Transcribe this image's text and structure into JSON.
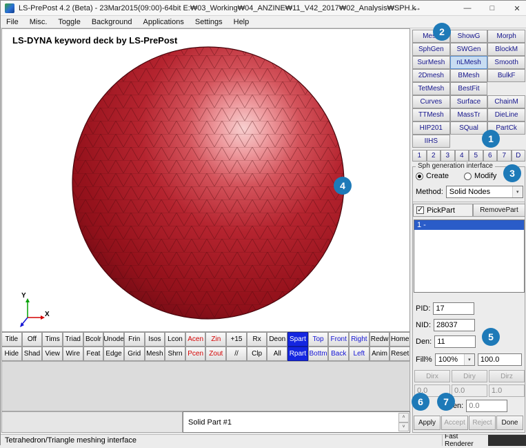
{
  "colors": {
    "annotation_blue": "#1e7ab8",
    "sphere_red": "#a01522",
    "toolbar_red_text": "#d40000",
    "toolbar_blue_text": "#1414d4",
    "toolbar_active_bg": "#1426e0",
    "panel_button_text": "#14148c",
    "selection_blue": "#2a5cc8"
  },
  "titlebar": {
    "app_title": "LS-PrePost 4.2 (Beta) - 23Mar2015(09:00)-64bit E:₩03_Working₩04_ANZINE₩11_V42_2017₩02_Analysis₩SPH.k",
    "resize_glyph": "↔",
    "minimize_glyph": "—",
    "maximize_glyph": "□",
    "close_glyph": "✕"
  },
  "menubar": {
    "items": [
      "File",
      "Misc.",
      "Toggle",
      "Background",
      "Applications",
      "Settings",
      "Help"
    ]
  },
  "viewport": {
    "caption": "LS-DYNA keyword deck by LS-PrePost",
    "axis_y_label": "Y",
    "axis_x_label": "X"
  },
  "mesh_tools": {
    "labels": [
      "Mesh",
      "ShowG",
      "Morph",
      "SphGen",
      "SWGen",
      "BlockM",
      "SurMesh",
      "nLMesh",
      "Smooth",
      "2Dmesh",
      "BMesh",
      "BulkF",
      "TetMesh",
      "BestFit",
      "",
      "Curves",
      "Surface",
      "ChainM",
      "TTMesh",
      "MassTr",
      "DieLine",
      "HIP201",
      "SQual",
      "PartCk",
      "IIHS",
      "",
      ""
    ]
  },
  "page_tabs": [
    "1",
    "2",
    "3",
    "4",
    "5",
    "6",
    "7",
    "D"
  ],
  "sph": {
    "group_title": "Sph generation interface",
    "create_label": "Create",
    "modify_label": "Modify",
    "method_label": "Method:",
    "method_value": "Solid Nodes",
    "dropdown_arrow": "▾",
    "pickpart_label": "PickPart",
    "removepart_label": "RemovePart",
    "part_list_item": "1 -",
    "pid_label": "PID:",
    "pid_value": "17",
    "nid_label": "NID:",
    "nid_value": "28037",
    "den_label": "Den:",
    "den_value": "11",
    "fill_label": "Fill%",
    "fill_value": "100%",
    "fill_amount": "100.0",
    "dirx_label": "Dirx",
    "diry_label": "Diry",
    "dirz_label": "Dirz",
    "dirx_value": "0.0",
    "diry_value": "0.0",
    "dirz_value": "1.0",
    "den2_label": "Den:",
    "den2_value": "0.0",
    "apply_label": "Apply",
    "accept_label": "Accept",
    "reject_label": "Reject",
    "done_label": "Done"
  },
  "toolbar": {
    "row1": [
      "Title",
      "Off",
      "Tims",
      "Triad",
      "Bcolr",
      "Unode",
      "Frin",
      "Isos",
      "Lcon",
      "Acen",
      "Zin",
      "+15",
      "Rx",
      "Deon",
      "Spart",
      "Top",
      "Front",
      "Right",
      "Redw",
      "Home"
    ],
    "row2": [
      "Hide",
      "Shad",
      "View",
      "Wire",
      "Feat",
      "Edge",
      "Grid",
      "Mesh",
      "Shrn",
      "Pcen",
      "Zout",
      "//",
      "Clp",
      "All",
      "Rpart",
      "Bottm",
      "Back",
      "Left",
      "Anim",
      "Reset"
    ]
  },
  "part_selector": {
    "value": "Solid Part #1",
    "up_glyph": "˄",
    "down_glyph": "˅"
  },
  "statusbar": {
    "left_text": "Tetrahedron/Triangle meshing interface",
    "renderer_text": "Fast Renderer"
  },
  "annotations": [
    "1",
    "2",
    "3",
    "4",
    "5",
    "6",
    "7"
  ]
}
